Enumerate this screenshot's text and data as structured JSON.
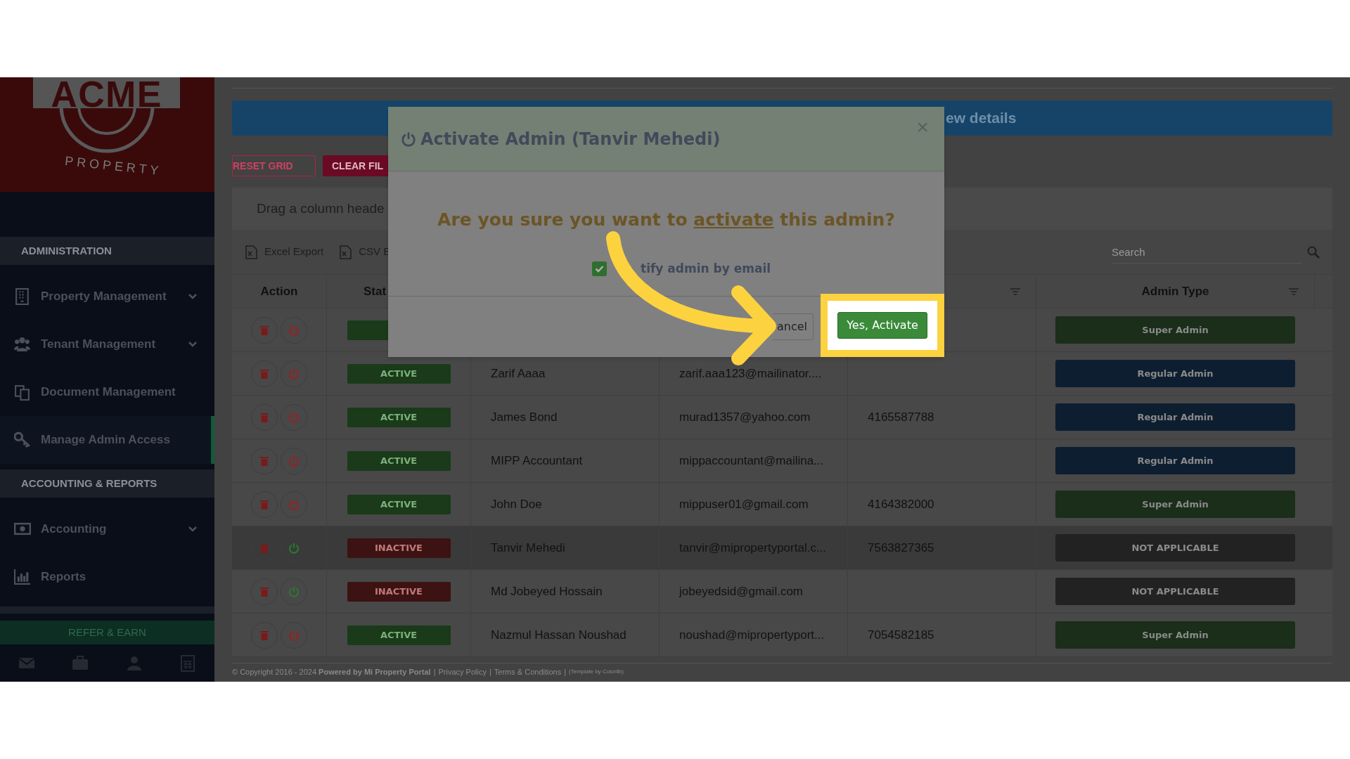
{
  "logo": {
    "wordmark": "ACME",
    "tagline": "PROPERTY"
  },
  "sidebar": {
    "sections": [
      {
        "heading": "ADMINISTRATION",
        "items": [
          {
            "label": "Property Management",
            "submenu": true,
            "selected": false
          },
          {
            "label": "Tenant Management",
            "submenu": true,
            "selected": false
          },
          {
            "label": "Document Management",
            "submenu": false,
            "selected": false
          },
          {
            "label": "Manage Admin Access",
            "submenu": false,
            "selected": true
          }
        ]
      },
      {
        "heading": "ACCOUNTING & REPORTS",
        "items": [
          {
            "label": "Accounting",
            "submenu": true,
            "selected": false
          },
          {
            "label": "Reports",
            "submenu": false,
            "selected": false
          }
        ]
      }
    ],
    "refer_button": "REFER & EARN"
  },
  "banner": "ew details",
  "grid_buttons": [
    {
      "label": "RESET GRID",
      "kind": "outline"
    },
    {
      "label": "CLEAR FIL",
      "kind": "solid"
    }
  ],
  "group_panel": "Drag a column heade",
  "toolbar": {
    "exports": [
      "Excel Export",
      "CSV E"
    ],
    "search": {
      "placeholder": "Search"
    }
  },
  "table": {
    "columns": [
      {
        "label": "Action",
        "filter": false
      },
      {
        "label": "Stat"
      },
      {},
      {},
      {
        "filter": true
      },
      {
        "label": "Admin Type",
        "filter": true
      }
    ],
    "rows": [
      {
        "active": true,
        "admin_type": {
          "label": "Super Admin",
          "color": "#1a2e1a"
        },
        "highlighted": false
      },
      {
        "status": "ACTIVE",
        "active": true,
        "name": "Zarif Aaaa",
        "email": "zarif.aaa123@mailinator....",
        "admin_type": {
          "label": "Regular Admin",
          "color": "#0d1e30"
        },
        "highlighted": false
      },
      {
        "status": "ACTIVE",
        "active": true,
        "name": "James Bond",
        "email": "murad1357@yahoo.com",
        "phone": "4165587788",
        "admin_type": {
          "label": "Regular Admin",
          "color": "#0d1e30"
        },
        "highlighted": false
      },
      {
        "status": "ACTIVE",
        "active": true,
        "name": "MIPP Accountant",
        "email": "mippaccountant@mailina...",
        "admin_type": {
          "label": "Regular Admin",
          "color": "#0d1e30"
        },
        "highlighted": false
      },
      {
        "status": "ACTIVE",
        "active": true,
        "name": "John Doe",
        "email": "mippuser01@gmail.com",
        "phone": "4164382000",
        "admin_type": {
          "label": "Super Admin",
          "color": "#1a2e1a"
        },
        "highlighted": false
      },
      {
        "status": "INACTIVE",
        "active": false,
        "name": "Tanvir Mehedi",
        "email": "tanvir@mipropertyportal.c...",
        "phone": "7563827365",
        "admin_type": {
          "label": "NOT APPLICABLE",
          "color": "#222222"
        },
        "highlighted": true
      },
      {
        "status": "INACTIVE",
        "active": false,
        "name": "Md Jobeyed Hossain",
        "email": "jobeyedsid@gmail.com",
        "admin_type": {
          "label": "NOT APPLICABLE",
          "color": "#222222"
        },
        "highlighted": false
      },
      {
        "status": "ACTIVE",
        "active": true,
        "name": "Nazmul Hassan Noushad",
        "email": "noushad@mipropertyport...",
        "phone": "7054582185",
        "admin_type": {
          "label": "Super Admin",
          "color": "#1a2e1a"
        },
        "highlighted": false
      }
    ]
  },
  "footer": {
    "copyright": "© Copyright 2016 - 2024 **Powered by Mi Property Portal**",
    "separator": "|",
    "links": [
      "Privacy Policy",
      "Terms & Conditions"
    ],
    "credit": "(Template by Colorlib)"
  },
  "modal": {
    "title": "Activate Admin (Tanvir Mehedi)",
    "close": "×",
    "question": [
      {
        "text": "Are you sure you want to",
        "underlined": false
      },
      {
        "text": "activate",
        "underlined": true
      },
      {
        "text": "this admin?",
        "underlined": false
      }
    ],
    "notify": {
      "label": "tify admin by email",
      "checked": true
    },
    "buttons": [
      {
        "label": "ancel",
        "kind": "secondary"
      },
      {
        "label": "Yes, Activate",
        "kind": "primary"
      }
    ]
  }
}
